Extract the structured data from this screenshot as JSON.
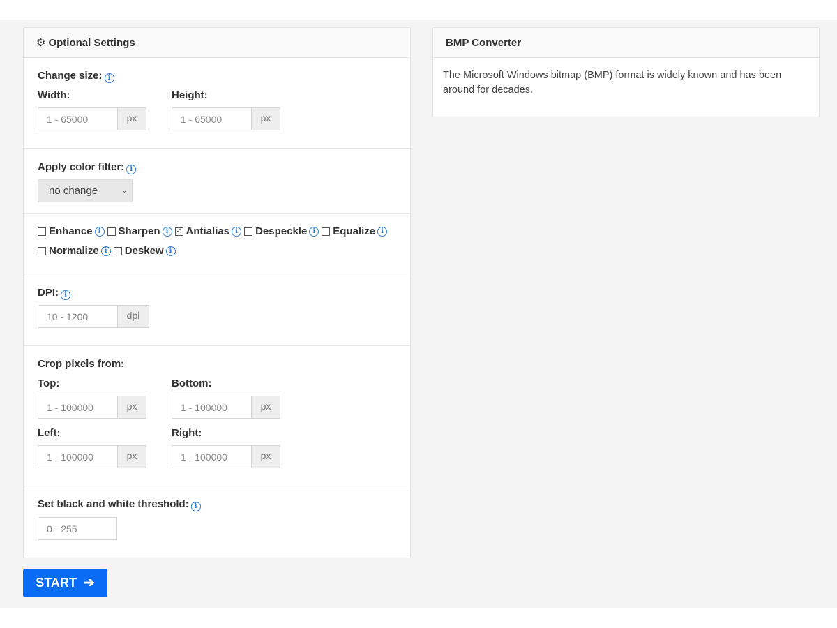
{
  "settings": {
    "title": "Optional Settings",
    "change_size": {
      "label": "Change size:",
      "width_label": "Width:",
      "height_label": "Height:",
      "width_placeholder": "1 - 65000",
      "height_placeholder": "1 - 65000",
      "unit": "px"
    },
    "color_filter": {
      "label": "Apply color filter:",
      "selected": "no change"
    },
    "options": [
      {
        "label": "Enhance",
        "checked": false
      },
      {
        "label": "Sharpen",
        "checked": false
      },
      {
        "label": "Antialias",
        "checked": true
      },
      {
        "label": "Despeckle",
        "checked": false
      },
      {
        "label": "Equalize",
        "checked": false
      },
      {
        "label": "Normalize",
        "checked": false
      },
      {
        "label": "Deskew",
        "checked": false
      }
    ],
    "dpi": {
      "label": "DPI:",
      "placeholder": "10 - 1200",
      "unit": "dpi"
    },
    "crop": {
      "label": "Crop pixels from:",
      "top_label": "Top:",
      "bottom_label": "Bottom:",
      "left_label": "Left:",
      "right_label": "Right:",
      "placeholder": "1 - 100000",
      "unit": "px"
    },
    "threshold": {
      "label": "Set black and white threshold:",
      "placeholder": "0 - 255"
    }
  },
  "start_button": {
    "label": "START"
  },
  "converter": {
    "title": "BMP Converter",
    "description": "The Microsoft Windows bitmap (BMP) format is widely known and has been around for decades."
  },
  "colors": {
    "accent": "#0a6cf5",
    "info": "#2f7fd4"
  }
}
